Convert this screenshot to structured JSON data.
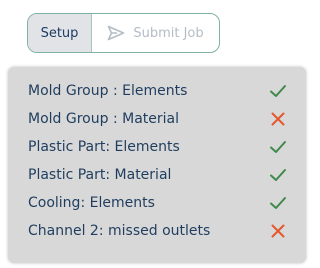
{
  "toolbar": {
    "setup_label": "Setup",
    "submit_label": "Submit Job",
    "submit_icon": "paper-plane-icon"
  },
  "colors": {
    "ok": "#3e8a48",
    "error": "#e4572e",
    "text": "#1f3d5e",
    "panel_bg": "#d8d8d8",
    "disabled_text": "#b4bcc4"
  },
  "checks": [
    {
      "label": "Mold Group : Elements",
      "status": "ok"
    },
    {
      "label": "Mold Group : Material",
      "status": "error"
    },
    {
      "label": "Plastic Part: Elements",
      "status": "ok"
    },
    {
      "label": "Plastic Part: Material",
      "status": "ok"
    },
    {
      "label": "Cooling: Elements",
      "status": "ok"
    },
    {
      "label": "Channel 2: missed outlets",
      "status": "error"
    }
  ]
}
